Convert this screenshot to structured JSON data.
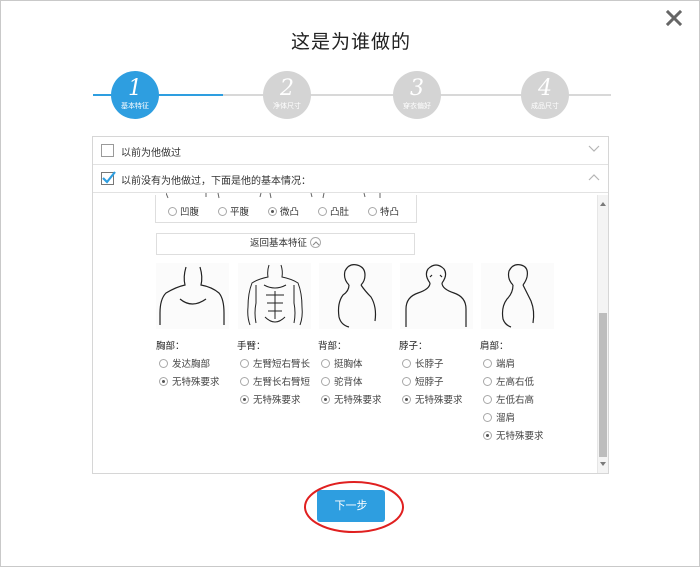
{
  "dialog": {
    "title": "这是为谁做的",
    "close_icon": "close-x-icon"
  },
  "steps": [
    {
      "num": "1",
      "label": "基本特征",
      "state": "active"
    },
    {
      "num": "2",
      "label": "净体尺寸",
      "state": "inactive"
    },
    {
      "num": "3",
      "label": "穿衣偏好",
      "state": "inactive"
    },
    {
      "num": "4",
      "label": "成品尺寸",
      "state": "inactive"
    }
  ],
  "options": {
    "made_before": {
      "label": "以前为他做过",
      "checked": false
    },
    "not_made_before": {
      "label": "以前没有为他做过，下面是他的基本情况：",
      "checked": true
    }
  },
  "belly": {
    "options": [
      "凹腹",
      "平腹",
      "微凸",
      "凸肚",
      "特凸"
    ],
    "selected": "微凸"
  },
  "back_button": {
    "label": "返回基本特征"
  },
  "features": [
    {
      "label": "胸部：",
      "options": [
        "发达胸部",
        "无特殊要求"
      ],
      "selected": "无特殊要求"
    },
    {
      "label": "手臂：",
      "options": [
        "左臂短右臂长",
        "左臂长右臂短",
        "无特殊要求"
      ],
      "selected": "无特殊要求"
    },
    {
      "label": "背部：",
      "options": [
        "挺胸体",
        "驼背体",
        "无特殊要求"
      ],
      "selected": "无特殊要求"
    },
    {
      "label": "脖子：",
      "options": [
        "长脖子",
        "短脖子",
        "无特殊要求"
      ],
      "selected": "无特殊要求"
    },
    {
      "label": "肩部：",
      "options": [
        "端肩",
        "左高右低",
        "左低右高",
        "溜肩",
        "无特殊要求"
      ],
      "selected": "无特殊要求"
    }
  ],
  "next_button": {
    "label": "下一步"
  },
  "colors": {
    "accent": "#2e9ee0",
    "highlight_ring": "#e02020"
  }
}
